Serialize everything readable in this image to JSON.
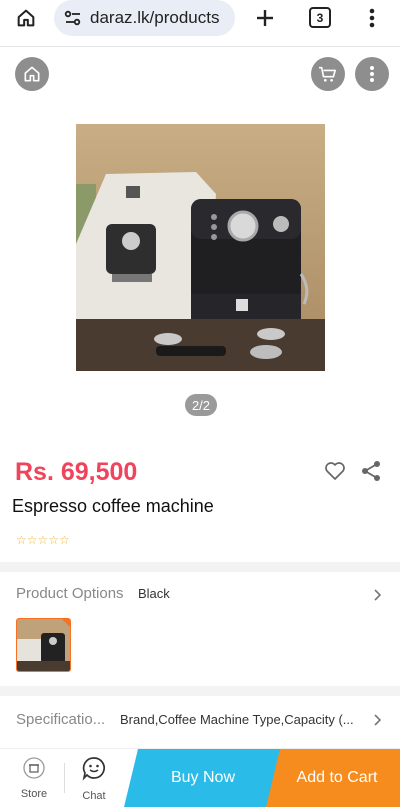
{
  "browser": {
    "url": "daraz.lk/products",
    "tab_count": "3",
    "icons": [
      "home-icon",
      "site-settings-icon",
      "new-tab-plus-icon",
      "tab-switcher-icon",
      "more-vert-icon"
    ]
  },
  "page_header": {
    "icons": [
      "home-icon",
      "cart-icon",
      "more-vert-icon"
    ]
  },
  "gallery": {
    "counter": "2/2"
  },
  "product": {
    "price": "Rs. 69,500",
    "title": "Espresso coffee machine",
    "rating_stars": "☆☆☆☆☆",
    "price_color": "#f0435c"
  },
  "options": {
    "label": "Product Options",
    "value": "Black"
  },
  "specifications": {
    "label": "Specificatio...",
    "value": "Brand,Coffee Machine Type,Capacity (..."
  },
  "bottom_bar": {
    "store_label": "Store",
    "chat_label": "Chat",
    "buy_now_label": "Buy Now",
    "add_to_cart_label": "Add to Cart",
    "buy_now_color": "#2abbe8",
    "add_to_cart_color": "#f68b1e"
  }
}
